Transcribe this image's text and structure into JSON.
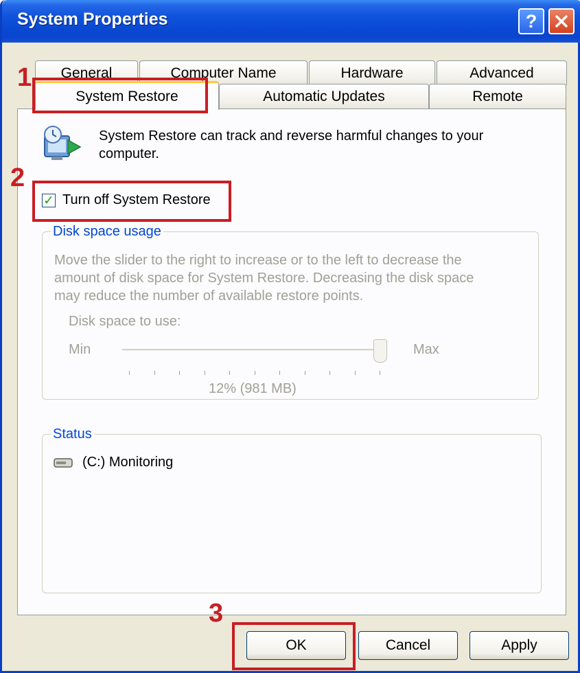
{
  "window": {
    "title": "System Properties",
    "help_button": "?",
    "close_button": "✕"
  },
  "tabs": {
    "row_back": [
      "General",
      "Computer Name",
      "Hardware",
      "Advanced"
    ],
    "row_front": [
      "System Restore",
      "Automatic Updates",
      "Remote"
    ],
    "active": "System Restore"
  },
  "panel": {
    "description_line1": "System Restore can track and reverse harmful changes to your",
    "description_line2": "computer.",
    "checkbox_label": "Turn off System Restore",
    "checkbox_checked": true,
    "checkmark": "✓"
  },
  "disk_usage": {
    "group_title": "Disk space usage",
    "info_line1": "Move the slider to the right to increase or to the left to decrease the",
    "info_line2": "amount of disk space for System Restore. Decreasing the disk space",
    "info_line3": "may reduce the number of available restore points.",
    "label": "Disk space to use:",
    "min_label": "Min",
    "max_label": "Max",
    "value_text": "12% (981 MB)",
    "slider_value_fraction": 1.0
  },
  "status": {
    "group_title": "Status",
    "drive_text": "(C:) Monitoring"
  },
  "buttons": {
    "ok": "OK",
    "cancel": "Cancel",
    "apply": "Apply"
  },
  "annotations": {
    "step1": "1",
    "step2": "2",
    "step3": "3",
    "color": "#C81E23"
  }
}
